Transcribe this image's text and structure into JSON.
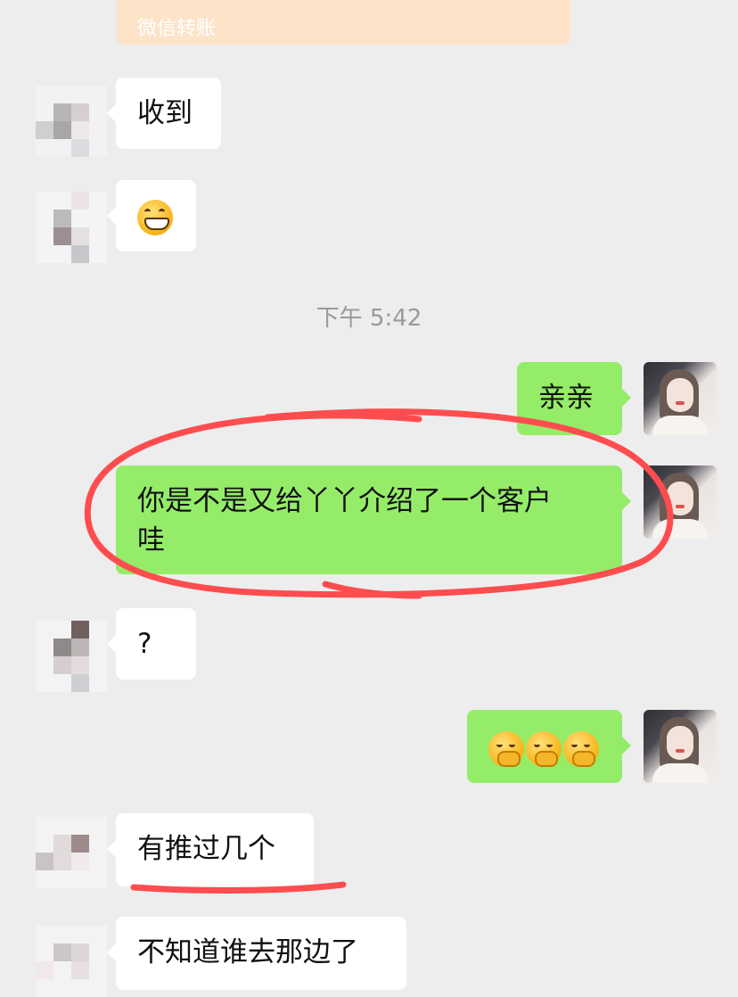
{
  "transfer_card": {
    "label": "微信转账"
  },
  "timestamp": "下午 5:42",
  "messages": [
    {
      "side": "in",
      "text": "收到"
    },
    {
      "side": "in",
      "text": "😁"
    },
    {
      "side": "out",
      "text": "亲亲"
    },
    {
      "side": "out",
      "text_line1": "你是不是又给丫丫介绍了一个客户",
      "text_line2": "哇"
    },
    {
      "side": "in",
      "text": "?"
    },
    {
      "side": "out",
      "text": "🤭🤭🤭"
    },
    {
      "side": "in",
      "text": "有推过几个"
    },
    {
      "side": "in",
      "text": "不知道谁去那边了"
    }
  ],
  "colors": {
    "background": "#ededed",
    "incoming_bubble": "#ffffff",
    "outgoing_bubble": "#95ec69",
    "annotation": "#ff4d4f",
    "transfer_card": "#fde3c8"
  },
  "annotations": [
    "red circle around message 4",
    "red underline under message 7"
  ]
}
